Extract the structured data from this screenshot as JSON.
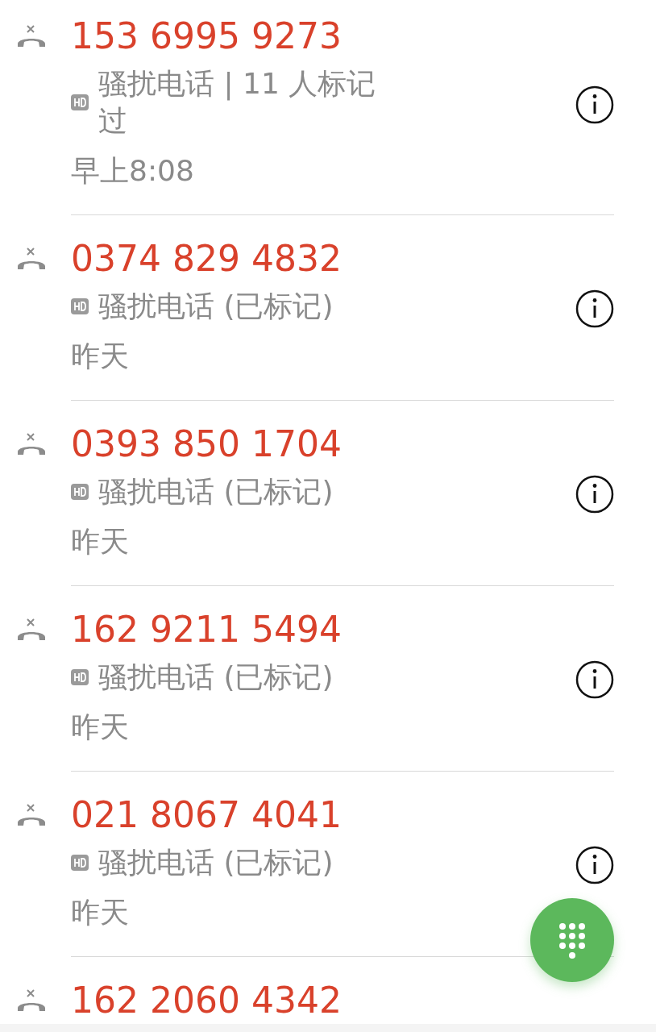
{
  "calls": [
    {
      "number": "153 6995 9273",
      "label": "骚扰电话 | 11 人标记过",
      "time": "早上8:08",
      "missed": true,
      "hd": true
    },
    {
      "number": "0374 829 4832",
      "label": "骚扰电话 (已标记)",
      "time": "昨天",
      "missed": true,
      "hd": true
    },
    {
      "number": "0393 850 1704",
      "label": "骚扰电话 (已标记)",
      "time": "昨天",
      "missed": true,
      "hd": true
    },
    {
      "number": "162 9211 5494",
      "label": "骚扰电话 (已标记)",
      "time": "昨天",
      "missed": true,
      "hd": true
    },
    {
      "number": "021 8067 4041",
      "label": "骚扰电话 (已标记)",
      "time": "昨天",
      "missed": true,
      "hd": true
    },
    {
      "number": "162 2060 4342",
      "missed": true
    }
  ]
}
